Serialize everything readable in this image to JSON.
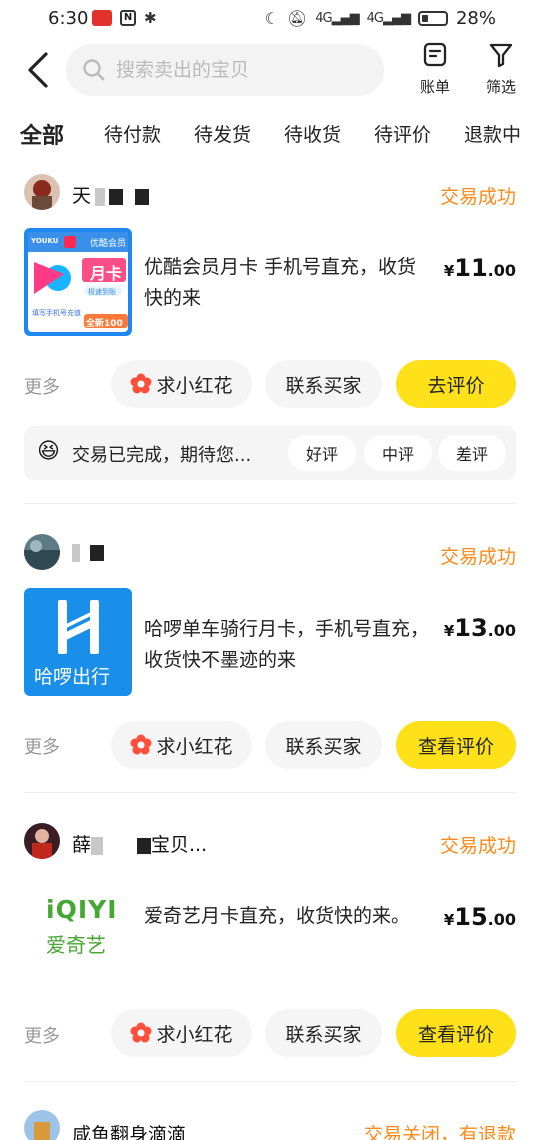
{
  "status_bar": {
    "time": "6:30",
    "battery": "28%",
    "battery_level": 0.28,
    "net_1": "4G",
    "net_2": "4G"
  },
  "header": {
    "search_placeholder": "搜索卖出的宝贝",
    "bill_label": "账单",
    "filter_label": "筛选"
  },
  "tabs": [
    "全部",
    "待付款",
    "待发货",
    "待收货",
    "待评价",
    "退款中"
  ],
  "colors": {
    "accent_yellow": "#ffe11a",
    "status_orange": "#ff8a1a",
    "flower_red": "#ff4f3a"
  },
  "orders": [
    {
      "seller": "天",
      "status": "交易成功",
      "thumb_badge": "YOUKU",
      "thumb_top": "优酷会员",
      "thumb_main": "月卡",
      "thumb_sub": "极速到账",
      "thumb_note": "填写手机号充值",
      "thumb_tag": "全新100",
      "title": "优酷会员月卡 手机号直充，收货快的来",
      "price_currency": "¥",
      "price_int": "11",
      "price_dec": ".00",
      "more": "更多",
      "btn_flower": "求小红花",
      "btn_contact": "联系买家",
      "btn_primary": "去评价",
      "review": {
        "emoji": "😆",
        "text": "交易已完成，期待您...",
        "good": "好评",
        "medium": "中评",
        "bad": "差评"
      }
    },
    {
      "seller": "",
      "status": "交易成功",
      "thumb_text": "哈啰出行",
      "title": "哈啰单车骑行月卡，手机号直充，收货快不墨迹的来",
      "price_currency": "¥",
      "price_int": "13",
      "price_dec": ".00",
      "more": "更多",
      "btn_flower": "求小红花",
      "btn_contact": "联系买家",
      "btn_primary": "查看评价"
    },
    {
      "seller": "薛",
      "seller_suffix": "宝贝...",
      "status": "交易成功",
      "thumb_logo": "iQIYI",
      "thumb_text": "爱奇艺",
      "title": "爱奇艺月卡直充，收货快的来。",
      "price_currency": "¥",
      "price_int": "15",
      "price_dec": ".00",
      "more": "更多",
      "btn_flower": "求小红花",
      "btn_contact": "联系买家",
      "btn_primary": "查看评价"
    },
    {
      "seller": "咸鱼翻身滴滴",
      "status": "交易关闭，有退款"
    }
  ]
}
